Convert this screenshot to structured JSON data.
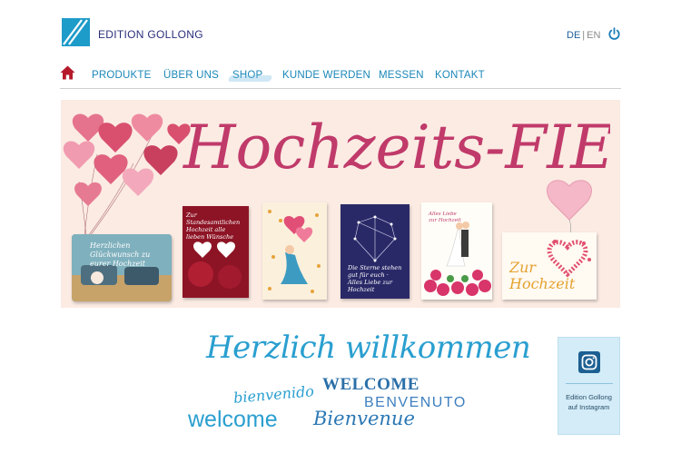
{
  "brand": {
    "name": "EDITION GOLLONG"
  },
  "language": {
    "active": "DE",
    "separator": "|",
    "other": "EN"
  },
  "nav": {
    "items": [
      {
        "label": "PRODUKTE"
      },
      {
        "label": "ÜBER UNS"
      },
      {
        "label": "SHOP"
      },
      {
        "label": "KUNDE WERDEN"
      },
      {
        "label": "MESSEN"
      },
      {
        "label": "KONTAKT"
      }
    ],
    "active": "SHOP"
  },
  "banner": {
    "title": "Hochzeits-FIEBER",
    "cards": [
      {
        "text": "Herzlichen Glückwunsch zu eurer Hochzeit"
      },
      {
        "text": "Zur Standesamtlichen Hochzeit alle lieben Wünsche"
      },
      {
        "text": ""
      },
      {
        "text": "Die Sterne stehen gut für euch · Alles Liebe zur Hochzeit"
      },
      {
        "text": "Alles Liebe zur Hochzeit"
      },
      {
        "text": "Zur Hochzeit"
      }
    ]
  },
  "welcome": {
    "headline": "Herzlich willkommen",
    "words": [
      "WELCOME",
      "bienvenido",
      "BENVENUTO",
      "welcome",
      "Bienvenue"
    ]
  },
  "instagram": {
    "text": "Edition Gollong auf Instagram"
  },
  "colors": {
    "accent": "#1d9bc9",
    "navText": "#1a87b8",
    "brandText": "#2a2f7a",
    "homeIcon": "#b5192a",
    "bannerBg": "#fbebe3"
  }
}
